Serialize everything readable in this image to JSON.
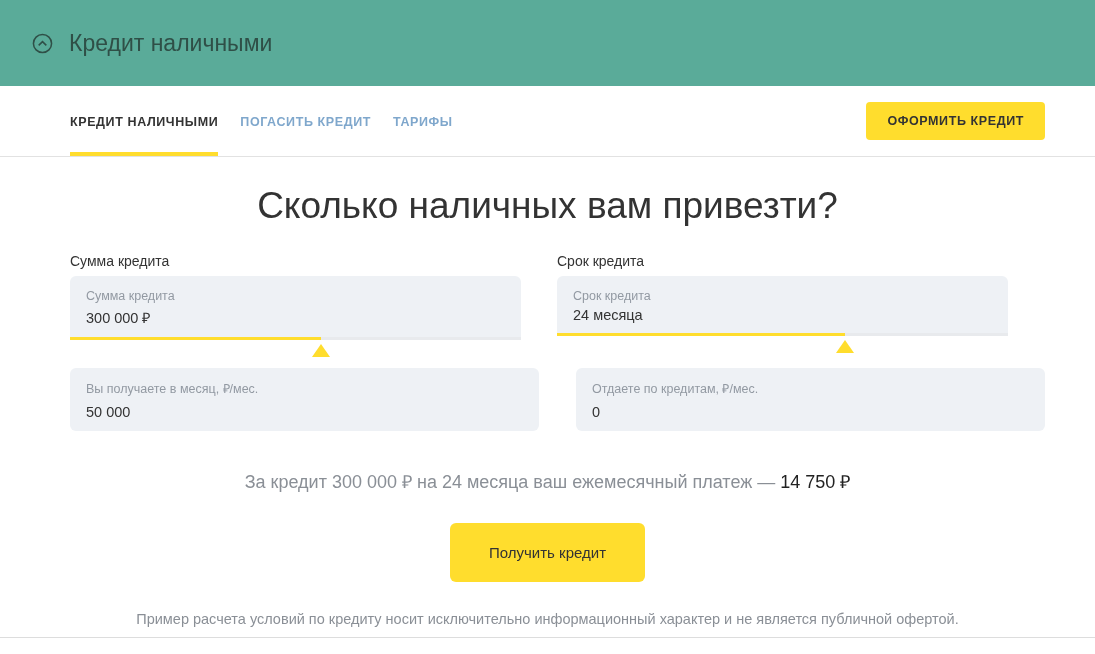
{
  "header": {
    "title": "Кредит наличными"
  },
  "tabs": [
    {
      "label": "КРЕДИТ НАЛИЧНЫМИ",
      "selected": true
    },
    {
      "label": "ПОГАСИТЬ КРЕДИТ",
      "selected": false
    },
    {
      "label": "ТАРИФЫ",
      "selected": false
    }
  ],
  "apply_button": "ОФОРМИТЬ КРЕДИТ",
  "heading": "Сколько наличных вам привезти?",
  "sliders": [
    {
      "caption": "Сумма кредита",
      "label": "Сумма кредита",
      "value": "300 000 ₽",
      "level": 0.556
    },
    {
      "caption": "Срок кредита",
      "label": "Срок кредита",
      "value": "24 месяца",
      "level": 0.638
    }
  ],
  "inputs": [
    {
      "label": "Вы получаете в месяц, ₽/мес.",
      "value": "50 000"
    },
    {
      "label": "Отдаете по кредитам, ₽/мес.",
      "value": "0"
    }
  ],
  "summary": "За кредит 300 000 ₽ на 24 месяца ваш ежемесячный платеж — **14 750 ₽**",
  "submit_button": "Получить кредит",
  "disclaimer": "Пример расчета условий по кредиту носит исключительно информационный характер и не является публичной офертой."
}
